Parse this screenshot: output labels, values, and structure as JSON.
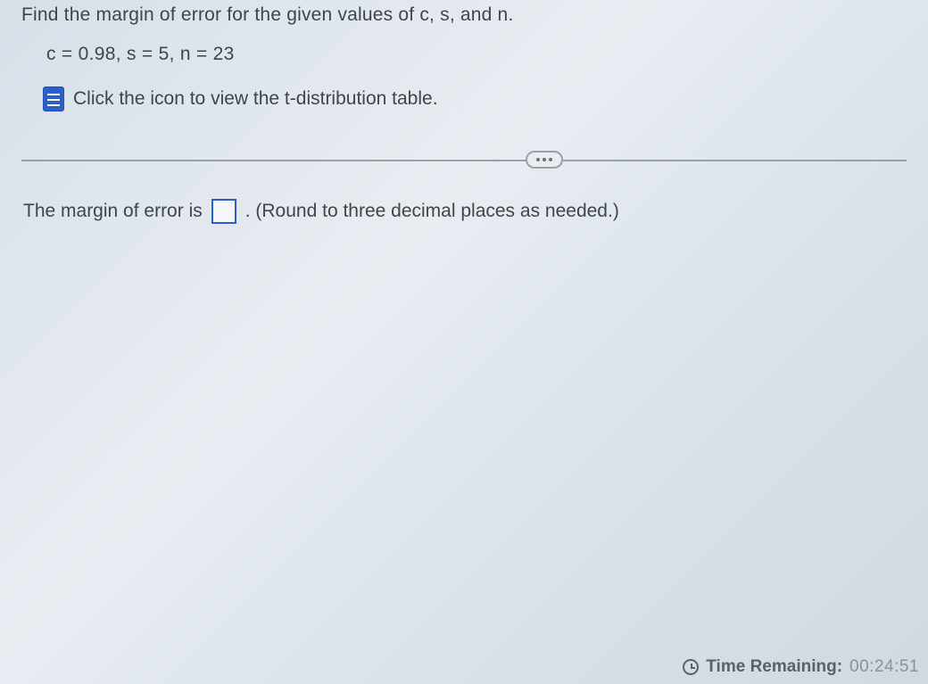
{
  "question": {
    "prompt": "Find the margin of error for the given values of c, s, and n.",
    "parameters": "c = 0.98, s = 5, n = 23",
    "hint_text": "Click the icon to view the t-distribution table."
  },
  "answer": {
    "prefix": "The margin of error is",
    "suffix": ". (Round to three decimal places as needed.)",
    "value": ""
  },
  "footer": {
    "time_label": "Time Remaining:",
    "time_value": "00:24:51"
  }
}
